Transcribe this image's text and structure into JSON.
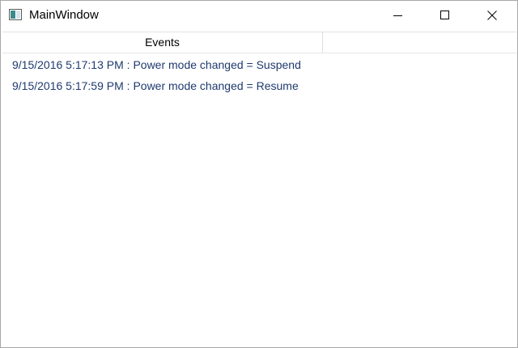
{
  "window": {
    "title": "MainWindow"
  },
  "listview": {
    "column_header": "Events",
    "rows": [
      "9/15/2016 5:17:13 PM : Power mode changed = Suspend",
      "9/15/2016 5:17:59 PM : Power mode changed = Resume"
    ]
  },
  "colors": {
    "row_text": "#1e3a6e",
    "window_border": "#a7a7a7"
  }
}
